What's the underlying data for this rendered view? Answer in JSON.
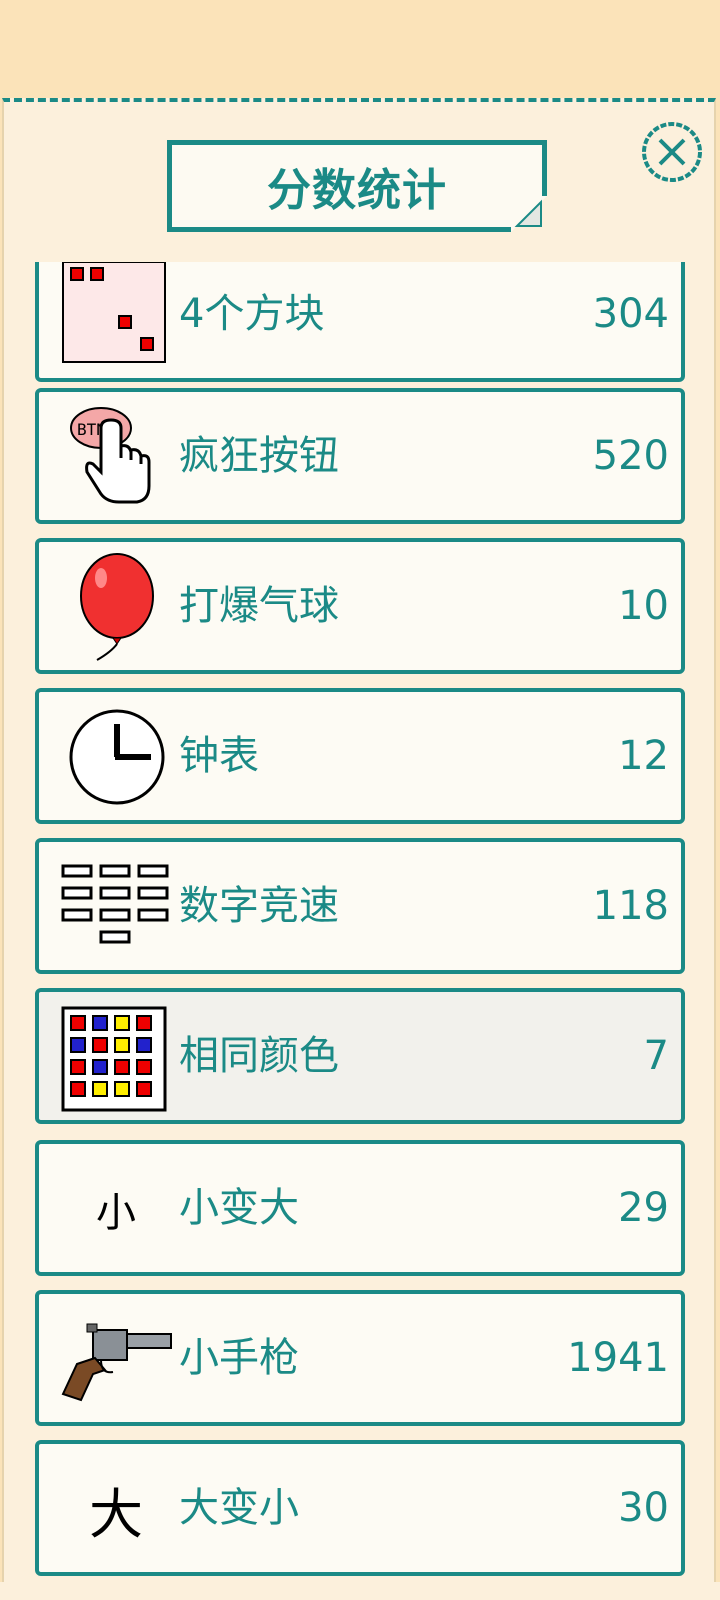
{
  "dialog": {
    "title": "分数统计"
  },
  "colors": {
    "accent": "#1b8a86",
    "background": "#fbe3b9",
    "panel": "#fcf0dc",
    "row": "#fdfbf4"
  },
  "rows": [
    {
      "label": "4个方块",
      "score": "304",
      "icon": "four-squares-icon"
    },
    {
      "label": "疯狂按钮",
      "score": "520",
      "icon": "pointer-button-icon"
    },
    {
      "label": "打爆气球",
      "score": "10",
      "icon": "balloon-icon"
    },
    {
      "label": "钟表",
      "score": "12",
      "icon": "clock-icon"
    },
    {
      "label": "数字竞速",
      "score": "118",
      "icon": "number-grid-icon"
    },
    {
      "label": "相同颜色",
      "score": "7",
      "icon": "color-grid-icon"
    },
    {
      "label": "小变大",
      "score": "29",
      "icon": "small-char-icon",
      "glyph": "小"
    },
    {
      "label": "小手枪",
      "score": "1941",
      "icon": "revolver-icon"
    },
    {
      "label": "大变小",
      "score": "30",
      "icon": "big-char-icon",
      "glyph": "大"
    }
  ]
}
